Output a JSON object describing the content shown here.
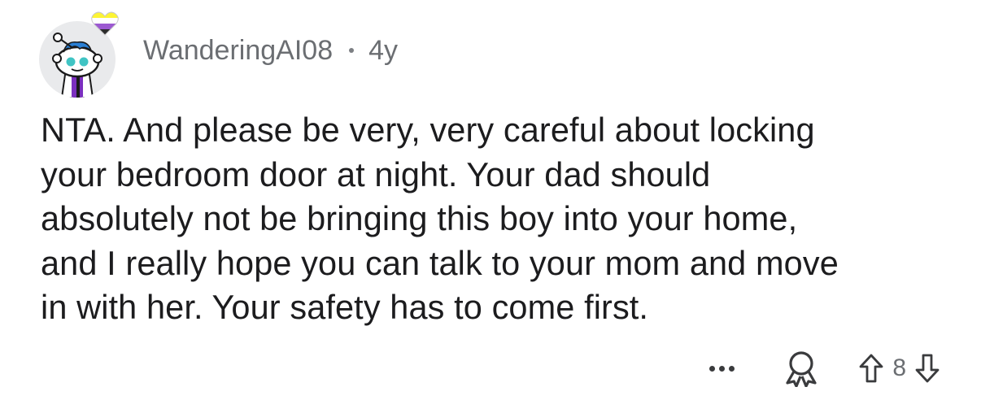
{
  "comment": {
    "author": "WanderingAI08",
    "age": "4y",
    "body_lines": [
      "NTA. And please be very, very careful about locking",
      "your bedroom door at night. Your dad should",
      "absolutely not be bringing this boy into your home,",
      "and I really hope you can talk to your mom and move",
      "in with her. Your safety has to come first."
    ],
    "score": "8",
    "icons": {
      "avatar": "snoo-avatar",
      "flair": "nonbinary-flag-heart-icon",
      "more": "ellipsis-icon",
      "award": "award-icon",
      "upvote": "arrow-up-icon",
      "downvote": "arrow-down-icon"
    },
    "colors": {
      "meta_text": "#6b6e72",
      "body_text": "#1c1c1e",
      "icon": "#3a3b3d",
      "flair_yellow": "#fcf434",
      "flair_white": "#ffffff",
      "flair_purple": "#9c59d1",
      "flair_black": "#2c2c2c"
    }
  }
}
